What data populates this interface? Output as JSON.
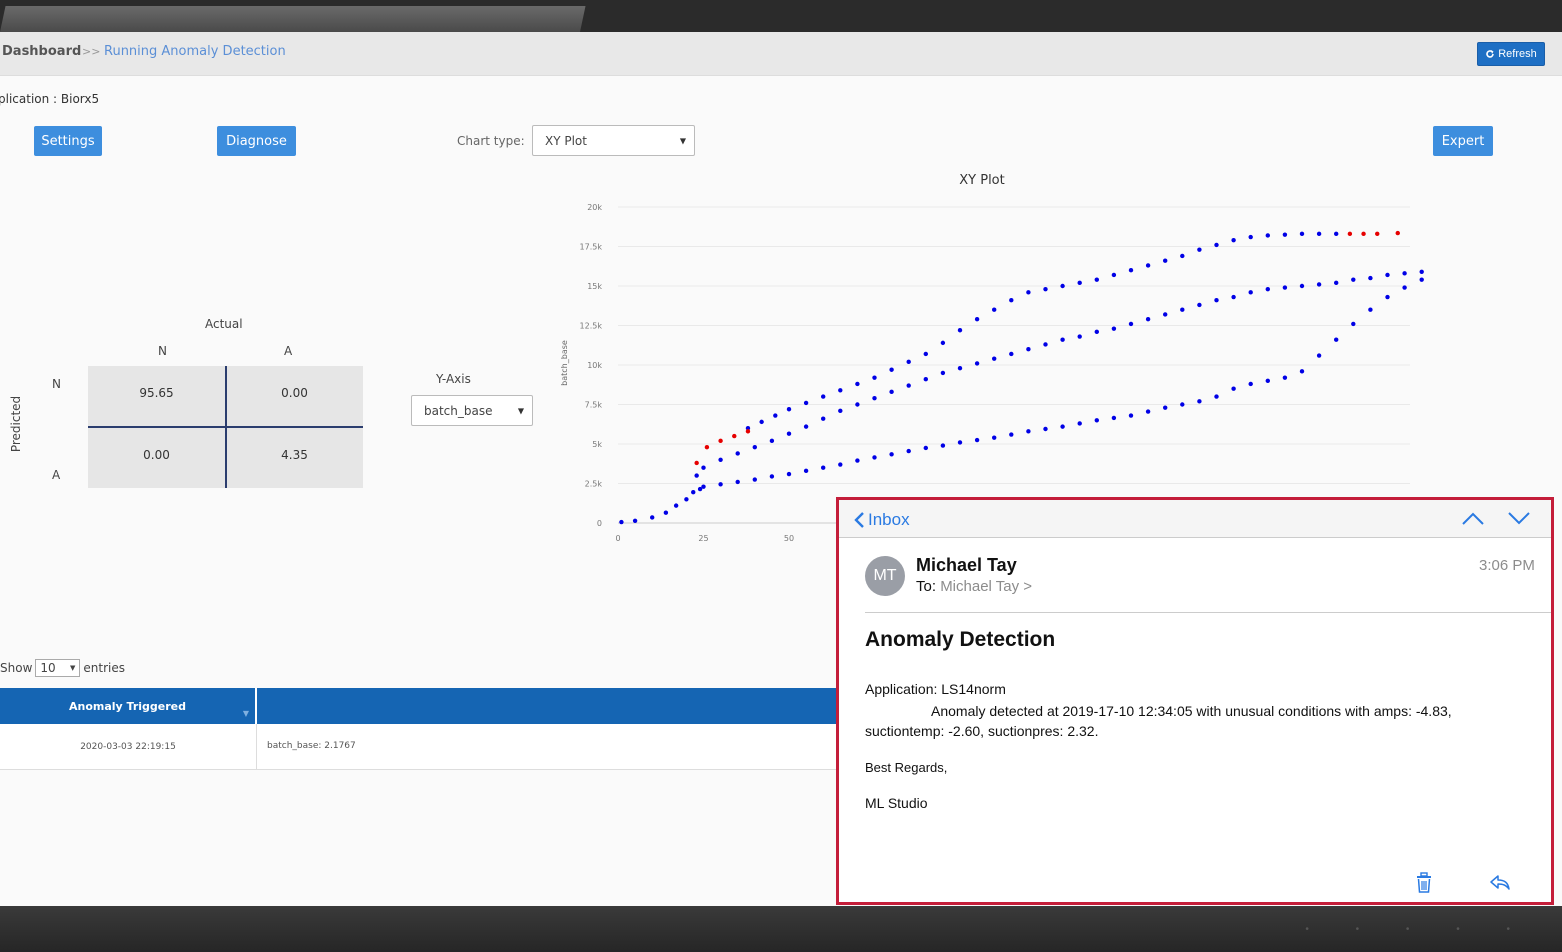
{
  "breadcrumb": {
    "home": "Dashboard",
    "separator": ">>",
    "current": "Running Anomaly Detection"
  },
  "toolbar": {
    "refresh_label": "Refresh",
    "refresh_icon": "refresh-icon"
  },
  "app": {
    "label": "plication : Biorx5"
  },
  "buttons": {
    "settings": "Settings",
    "diagnose": "Diagnose",
    "expert": "Expert"
  },
  "chart_type": {
    "label": "Chart type:",
    "selected": "XY Plot"
  },
  "confusion_matrix": {
    "actual_label": "Actual",
    "predicted_label": "Predicted",
    "col_labels": [
      "N",
      "A"
    ],
    "row_labels": [
      "N",
      "A"
    ],
    "cells": [
      [
        "95.65",
        "0.00"
      ],
      [
        "0.00",
        "4.35"
      ]
    ]
  },
  "y_axis": {
    "label": "Y-Axis",
    "selected": "batch_base"
  },
  "chart_data": {
    "type": "scatter",
    "title": "XY Plot",
    "xlabel": "",
    "ylabel": "batch_base",
    "x_ticks": [
      "0",
      "25",
      "50"
    ],
    "y_ticks": [
      "0",
      "2.5k",
      "5k",
      "7.5k",
      "10k",
      "12.5k",
      "15k",
      "17.5k",
      "20k"
    ],
    "ylim": [
      0,
      20000
    ],
    "xlim": [
      0,
      230
    ],
    "grid": true,
    "normal_color": "#0000e6",
    "anomaly_color": "#e60000",
    "series": [
      {
        "values": [
          [
            1,
            60
          ],
          [
            5,
            140
          ],
          [
            10,
            350
          ],
          [
            14,
            650
          ],
          [
            17,
            1100
          ],
          [
            20,
            1500
          ],
          [
            22,
            1950
          ],
          [
            24,
            2150
          ],
          [
            25,
            2300
          ],
          [
            30,
            2450
          ],
          [
            35,
            2600
          ],
          [
            40,
            2750
          ],
          [
            45,
            2950
          ],
          [
            50,
            3100
          ],
          [
            55,
            3300
          ],
          [
            60,
            3500
          ],
          [
            65,
            3700
          ],
          [
            70,
            3950
          ],
          [
            75,
            4150
          ],
          [
            80,
            4350
          ],
          [
            85,
            4550
          ],
          [
            90,
            4750
          ],
          [
            95,
            4900
          ],
          [
            100,
            5100
          ],
          [
            105,
            5250
          ],
          [
            110,
            5400
          ],
          [
            115,
            5600
          ],
          [
            120,
            5800
          ],
          [
            125,
            5950
          ],
          [
            130,
            6100
          ],
          [
            135,
            6300
          ],
          [
            140,
            6500
          ],
          [
            145,
            6650
          ],
          [
            150,
            6800
          ],
          [
            155,
            7050
          ],
          [
            160,
            7300
          ],
          [
            165,
            7500
          ],
          [
            170,
            7700
          ],
          [
            175,
            8000
          ],
          [
            180,
            8500
          ],
          [
            185,
            8800
          ],
          [
            190,
            9000
          ],
          [
            195,
            9200
          ],
          [
            200,
            9600
          ],
          [
            205,
            10600
          ],
          [
            210,
            11600
          ],
          [
            215,
            12600
          ],
          [
            220,
            13500
          ],
          [
            225,
            14300
          ],
          [
            230,
            14900
          ],
          [
            235,
            15400
          ],
          [
            238,
            15900
          ]
        ]
      },
      {
        "values": [
          [
            23,
            3000
          ],
          [
            25,
            3500
          ],
          [
            30,
            4000
          ],
          [
            35,
            4400
          ],
          [
            40,
            4800
          ],
          [
            45,
            5200
          ],
          [
            50,
            5650
          ],
          [
            55,
            6100
          ],
          [
            60,
            6600
          ],
          [
            65,
            7100
          ],
          [
            70,
            7500
          ],
          [
            75,
            7900
          ],
          [
            80,
            8300
          ],
          [
            85,
            8700
          ],
          [
            90,
            9100
          ],
          [
            95,
            9500
          ],
          [
            100,
            9800
          ],
          [
            105,
            10100
          ],
          [
            110,
            10400
          ],
          [
            115,
            10700
          ],
          [
            120,
            11000
          ],
          [
            125,
            11300
          ],
          [
            130,
            11600
          ],
          [
            135,
            11800
          ],
          [
            140,
            12100
          ],
          [
            145,
            12300
          ],
          [
            150,
            12600
          ],
          [
            155,
            12900
          ],
          [
            160,
            13200
          ],
          [
            165,
            13500
          ],
          [
            170,
            13800
          ],
          [
            175,
            14100
          ],
          [
            180,
            14300
          ],
          [
            185,
            14600
          ],
          [
            190,
            14800
          ],
          [
            195,
            14900
          ],
          [
            200,
            15000
          ],
          [
            205,
            15100
          ],
          [
            210,
            15200
          ],
          [
            215,
            15400
          ],
          [
            220,
            15500
          ],
          [
            225,
            15700
          ],
          [
            230,
            15800
          ],
          [
            235,
            15900
          ]
        ]
      },
      {
        "values": [
          [
            38,
            6000
          ],
          [
            42,
            6400
          ],
          [
            46,
            6800
          ],
          [
            50,
            7200
          ],
          [
            55,
            7600
          ],
          [
            60,
            8000
          ],
          [
            65,
            8400
          ],
          [
            70,
            8800
          ],
          [
            75,
            9200
          ],
          [
            80,
            9700
          ],
          [
            85,
            10200
          ],
          [
            90,
            10700
          ],
          [
            95,
            11400
          ],
          [
            100,
            12200
          ],
          [
            105,
            12900
          ],
          [
            110,
            13500
          ],
          [
            115,
            14100
          ],
          [
            120,
            14600
          ],
          [
            125,
            14800
          ],
          [
            130,
            15000
          ],
          [
            135,
            15200
          ],
          [
            140,
            15400
          ],
          [
            145,
            15700
          ],
          [
            150,
            16000
          ],
          [
            155,
            16300
          ],
          [
            160,
            16600
          ],
          [
            165,
            16900
          ],
          [
            170,
            17300
          ],
          [
            175,
            17600
          ],
          [
            180,
            17900
          ],
          [
            185,
            18100
          ],
          [
            190,
            18200
          ],
          [
            195,
            18250
          ],
          [
            200,
            18300
          ],
          [
            205,
            18300
          ],
          [
            210,
            18300
          ]
        ]
      },
      {
        "name": "anomaly",
        "values": [
          [
            23,
            3800
          ],
          [
            26,
            4800
          ],
          [
            30,
            5200
          ],
          [
            34,
            5500
          ],
          [
            38,
            5800
          ],
          [
            214,
            18300
          ],
          [
            218,
            18300
          ],
          [
            222,
            18300
          ],
          [
            228,
            18350
          ]
        ]
      }
    ]
  },
  "table": {
    "show_label": "Show",
    "page_size": "10",
    "entries_label": "entries",
    "columns": [
      "Anomaly Triggered",
      ""
    ],
    "rows": [
      [
        "2020-03-03 22:19:15",
        "batch_base: 2.1767"
      ]
    ]
  },
  "mail": {
    "back_label": "Inbox",
    "avatar_initials": "MT",
    "sender": "Michael Tay",
    "to_label": "To:",
    "to_name": "Michael Tay >",
    "time": "3:06 PM",
    "subject": "Anomaly Detection",
    "application_line": "Application: LS14norm",
    "detail": "Anomaly detected at 2019-17-10 12:34:05  with unusual conditions with  amps: -4.83, suctiontemp: -2.60, suctionpres: 2.32.",
    "regards": "Best Regards,",
    "signature": "ML Studio",
    "accent_color": "#2a7ae2",
    "border_color": "#c41e3a"
  }
}
